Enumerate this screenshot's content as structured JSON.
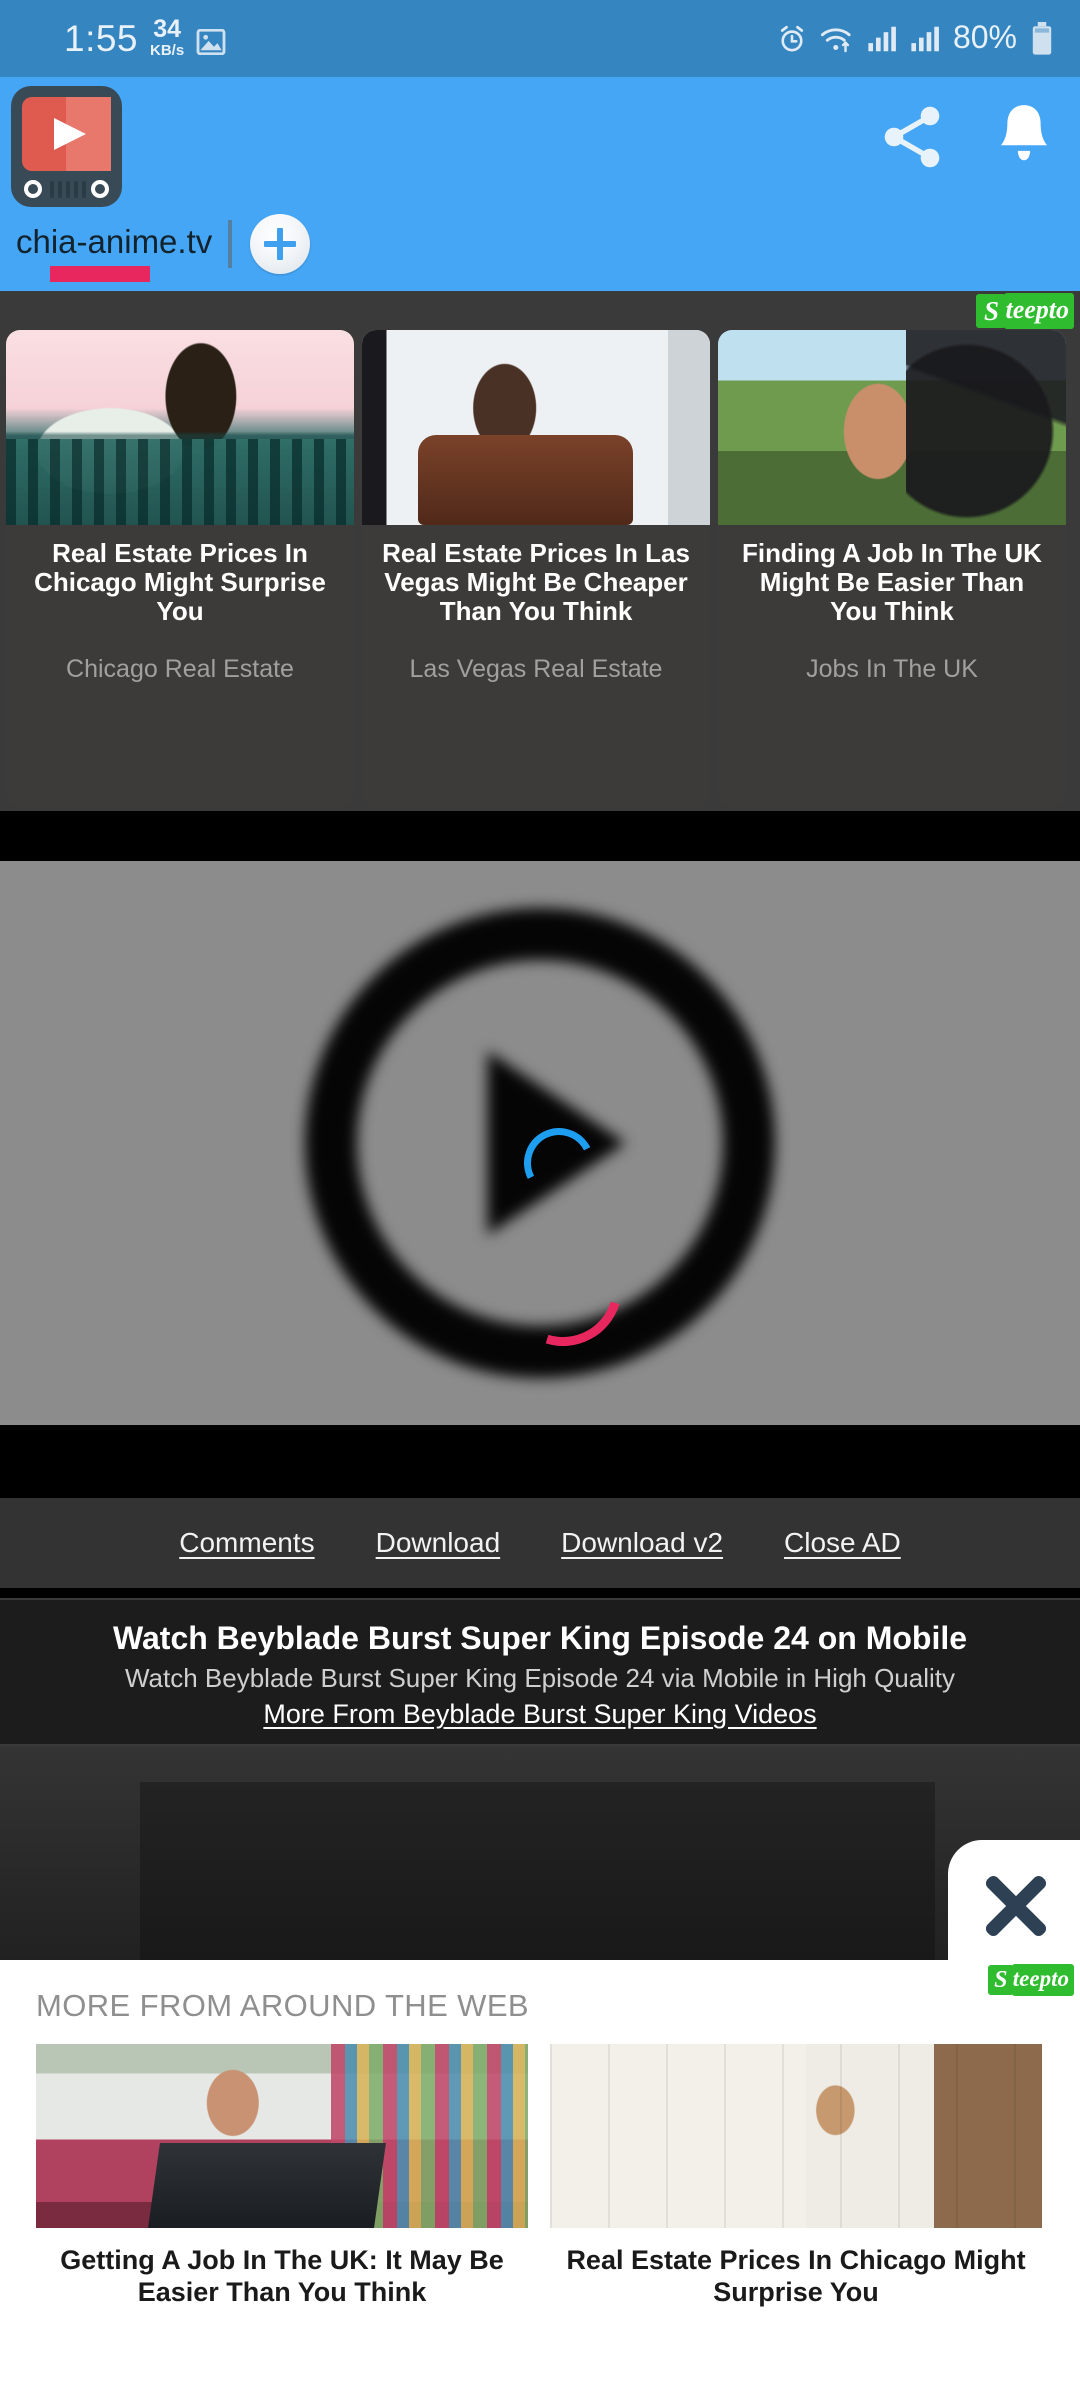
{
  "statusbar": {
    "time": "1:55",
    "net_rate_value": "34",
    "net_rate_unit": "KB/s",
    "battery_percent": "80%",
    "icons": [
      "image-icon",
      "alarm-icon",
      "wifi-icon",
      "signal-bars-icon",
      "signal-bars-2-icon",
      "battery-icon"
    ]
  },
  "appbar": {
    "app_icon_name": "video-player-app-icon",
    "share_label": "share-icon",
    "bell_label": "bell-icon",
    "tab_label": "chia-anime.tv",
    "new_tab_label": "+",
    "accent_color": "#e8275f",
    "bar_color": "#45a6f5"
  },
  "top_ad": {
    "network_logo": "Steepto",
    "network_logo_initial": "S",
    "network_logo_rest": "teepto",
    "cards": [
      {
        "title": "Real Estate Prices In Chicago Might Surprise You",
        "brand": "Chicago Real Estate",
        "image_name": "woman-leaning-chicago-skyline-photo"
      },
      {
        "title": "Real Estate Prices In Las Vegas Might Be Cheaper Than You Think",
        "brand": "Las Vegas Real Estate",
        "image_name": "woman-in-leather-armchair-photo"
      },
      {
        "title": "Finding A Job In The UK Might Be Easier Than You Think",
        "brand": "Jobs In The UK",
        "image_name": "woman-driving-car-photo"
      }
    ]
  },
  "player": {
    "state": "loading",
    "play_icon": "play-button-icon",
    "spinner": "loading-spinner",
    "background_color": "#8c8c8c"
  },
  "links": [
    {
      "label": "Comments"
    },
    {
      "label": "Download "
    },
    {
      "label": "Download v2"
    },
    {
      "label": "Close AD"
    }
  ],
  "title_card": {
    "heading": "Watch Beyblade Burst Super King Episode 24 on Mobile",
    "subheading": "Watch Beyblade Burst Super King Episode 24 via Mobile in High Quality",
    "more_link": "More From Beyblade Burst Super King Videos"
  },
  "bottom_ad": {
    "heading": "MORE FROM AROUND THE WEB",
    "network_logo_initial": "S",
    "network_logo_rest": "teepto",
    "close_label": "close-icon",
    "cards": [
      {
        "title": "Getting A Job In The UK: It May Be Easier Than You Think",
        "image_name": "woman-with-laptop-in-car-photo"
      },
      {
        "title": "Real Estate Prices In Chicago Might Surprise You",
        "image_name": "couple-in-kitchen-photo"
      }
    ]
  }
}
